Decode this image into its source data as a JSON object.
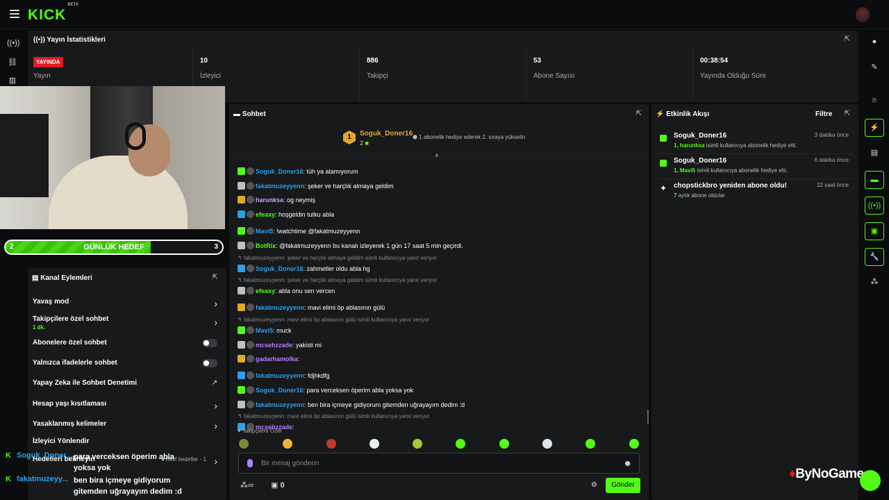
{
  "brand": {
    "logo": "KICK",
    "beta": "BETA"
  },
  "stats": {
    "title": "Yayın İstatistikleri",
    "live_badge": "YAYINDA",
    "live_label": "Yayın",
    "viewers_value": "10",
    "viewers_label": "İzleyici",
    "followers_value": "886",
    "followers_label": "Takipçi",
    "subs_value": "53",
    "subs_label": "Abone Sayısı",
    "uptime_value": "00:38:54",
    "uptime_label": "Yayında Olduğu Süre"
  },
  "goal": {
    "label": "GÜNLÜK HEDEF",
    "current": "2",
    "target": "3",
    "progress": 0.67
  },
  "actions": {
    "title": "Kanal Eylemleri",
    "items": [
      {
        "label": "Yavaş mod"
      },
      {
        "label": "Takipçilere özel sohbet",
        "sub": "1 dk."
      },
      {
        "label": "Abonelere özel sohbet"
      },
      {
        "label": "Yalnızca ifadelerle sohbet"
      },
      {
        "label": "Yapay Zeka ile Sohbet Denetimi"
      },
      {
        "label": "Hesap yaşı kısıtlaması"
      },
      {
        "label": "Yasaklanmış kelimeler"
      },
      {
        "label": "İzleyici Yönlendir"
      },
      {
        "label": "Hedefleri belirleyin",
        "sub": "Aktif hedefler - 1"
      }
    ]
  },
  "overlay": [
    {
      "user": "Soguk_Doner...",
      "text": "para verceksen öperim abla yoksa yok"
    },
    {
      "user": "fakatmuzeyy...",
      "text": "ben bira içmeye gidiyorum gitemden uğrayayım dedim :d"
    }
  ],
  "chat": {
    "title": "Sohbet",
    "pinned_user": "Soguk_Doner16",
    "pinned_rank": "1",
    "pinned_count": "2",
    "pinned_text": "1 abonelik hediye ederek 2. sıraya yükselin",
    "messages": [
      {
        "user": "Soguk_Doner16",
        "color": "#2f9ee8",
        "text": ": tüh ya alamıyorum"
      },
      {
        "user": "fakatmuzeyyenn",
        "color": "#2f9ee8",
        "text": ": şeker ve harçlık almaya geldim"
      },
      {
        "user": "harunksa",
        "color": "#c9a4ff",
        "text": ": og neymiş"
      },
      {
        "user": "efeaxy",
        "color": "#53fc18",
        "text": ": hoşgeldin tutku abla"
      },
      {
        "user": "Mavi5",
        "color": "#2f9ee8",
        "text": ": !watchtime @fakatmuzeyyenn"
      },
      {
        "user": "BotRix",
        "color": "#53fc18",
        "text": ": @fakatmuzeyyenn bu kanalı izleyerek 1 gün 17 saat 5 min geçirdi."
      },
      {
        "reply": "fakatmuzeyyenn: şeker ve harçlık almaya geldim isimli kullanıcıya yanıt veriyor"
      },
      {
        "user": "Soguk_Doner16",
        "color": "#2f9ee8",
        "text": ": zahmetler oldu abla hg"
      },
      {
        "reply": "fakatmuzeyyenn: şeker ve harçlık almaya geldim isimli kullanıcıya yanıt veriyor"
      },
      {
        "user": "efeaxy",
        "color": "#53fc18",
        "text": ": abla onu sen vercen"
      },
      {
        "user": "fakatmuzeyyenn",
        "color": "#2f9ee8",
        "text": ": mavi elimi öp ablasının gülü"
      },
      {
        "reply": "fakatmuzeyyenn: mavi elimi öp ablasının gülü isimli kullanıcıya yanıt veriyor"
      },
      {
        "user": "Mavi5",
        "color": "#2f9ee8",
        "text": ": muck"
      },
      {
        "user": "mcsehzzade",
        "color": "#b67cff",
        "text": ": yakisti mi"
      },
      {
        "user": "gadarhamolka",
        "color": "#b67cff",
        "text": ":"
      },
      {
        "user": "fakatmuzeyyenn",
        "color": "#2f9ee8",
        "text": ": fdjhkdfg"
      },
      {
        "user": "Soguk_Doner16",
        "color": "#2f9ee8",
        "text": ": para verceksen öperim abla yoksa yok"
      },
      {
        "user": "fakatmuzeyyenn",
        "color": "#2f9ee8",
        "text": ": ben bira içmeye gidiyorum gitemden uğrayayım dedim :d"
      },
      {
        "reply": "fakatmuzeyyenn: mavi elimi öp ablasının gülü isimli kullanıcıya yanıt veriyor"
      },
      {
        "user": "mcsehzzade",
        "color": "#b67cff",
        "text": ":"
      }
    ],
    "emote_section": "Takipçilere Özel",
    "input_placeholder": "Bir mesaj gönderin",
    "points": "0",
    "send_label": "Gönder"
  },
  "activity": {
    "title": "Etkinlik Akışı",
    "filter_label": "Filtre",
    "items": [
      {
        "actor": "Soguk_Doner16",
        "time": "3 dakika önce",
        "highlight": "1, harunksa",
        "detail": " isimli kullanıcıya abonelik hediye etti."
      },
      {
        "actor": "Soguk_Doner16",
        "time": "6 dakika önce",
        "highlight": "1, Mavi5",
        "detail": " isimli kullanıcıya abonelik hediye etti."
      },
      {
        "actor": "chopstickbro yeniden abone oldu!",
        "time": "22 saat önce",
        "highlight": "7",
        "detail": " aylık abone oldular"
      }
    ]
  },
  "watermark": "ByNoGame",
  "colors": {
    "accent": "#53fc18",
    "live": "#e01b24",
    "panel": "#18191b",
    "bg": "#0b0c0d"
  }
}
